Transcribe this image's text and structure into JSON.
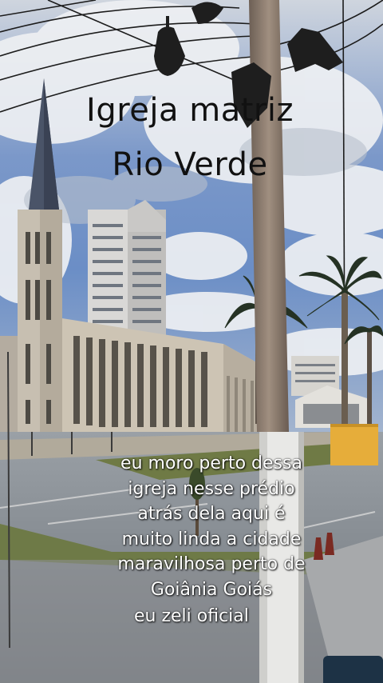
{
  "overlay": {
    "title_lines": [
      "Igreja matriz",
      "Rio Verde"
    ],
    "caption_lines": [
      "eu moro perto dessa",
      "igreja nesse prédio",
      "atrás dela aqui é",
      "muito linda a cidade",
      "maravilhosa perto de",
      "Goiânia Goiás"
    ],
    "signature": "eu zeli oficial"
  },
  "colors": {
    "sky": "#6d8fc4",
    "cloud": "#e9ecf1",
    "church": "#cfc5b5",
    "tower": "#4a5468",
    "road": "#8a8f95",
    "grass": "#7c8a4f",
    "palm": "#2c3a2a",
    "pole": "#8d7d70",
    "caption_text": "#ffffff",
    "title_text": "#111111"
  }
}
